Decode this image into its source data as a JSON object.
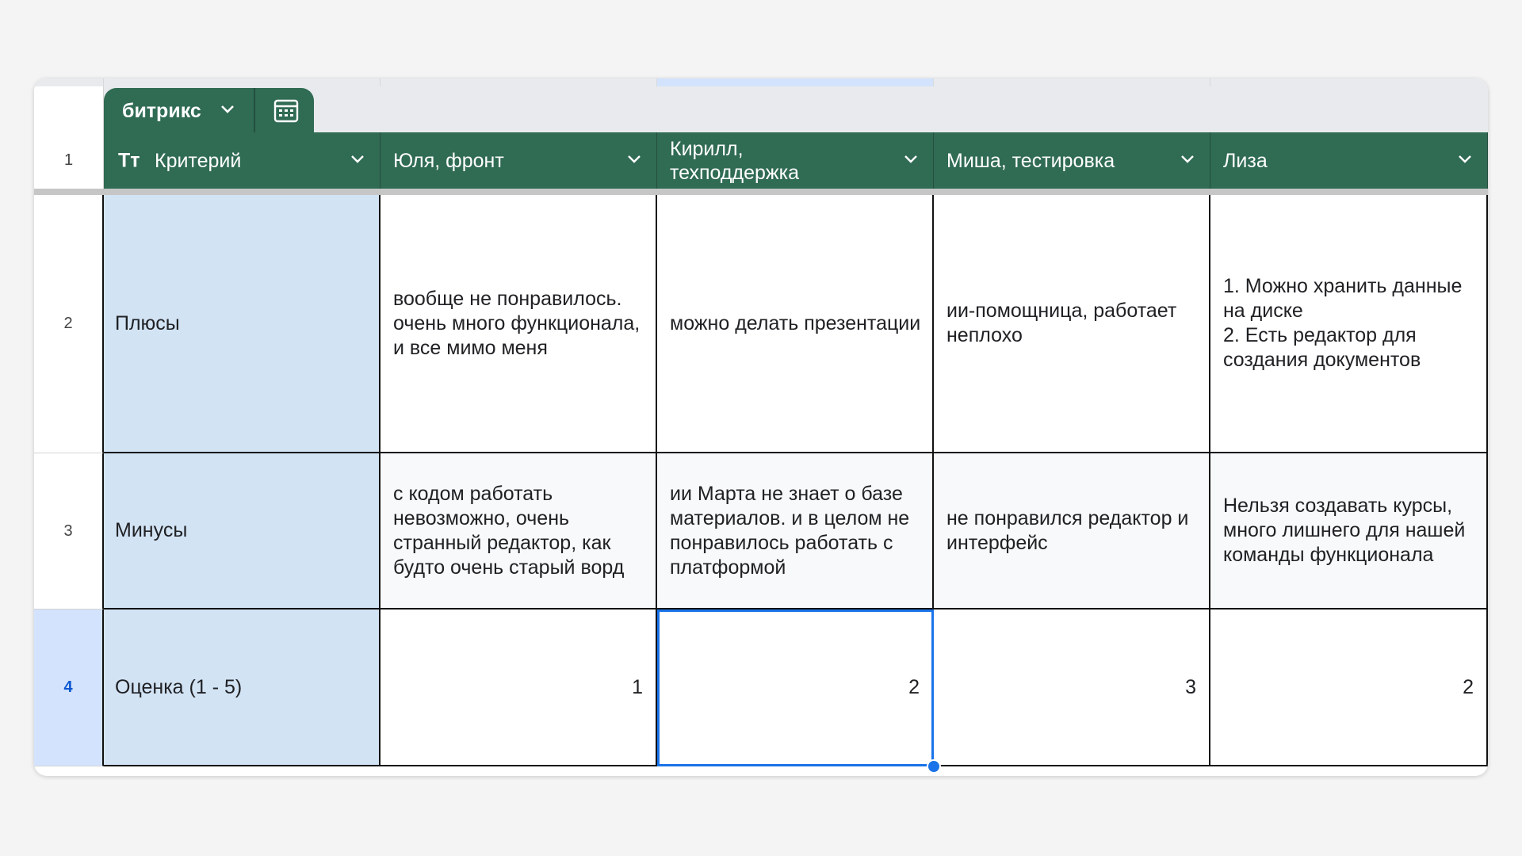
{
  "sheet_tab": {
    "name": "битрикс"
  },
  "header_row_number": "1",
  "columns": [
    {
      "label": "Критерий",
      "type_icon": "Тт"
    },
    {
      "label": "Юля, фронт"
    },
    {
      "label": "Кирилл, техподдержка"
    },
    {
      "label": "Миша, тестировка"
    },
    {
      "label": "Лиза"
    }
  ],
  "rows": [
    {
      "num": "2",
      "criterion": "Плюсы",
      "cells": [
        "вообще не понравилось. очень много функционала, и все мимо меня",
        "можно делать презентации",
        "ии-помощница, работает неплохо",
        "1. Можно хранить данные на диске\n2. Есть редактор для создания документов"
      ]
    },
    {
      "num": "3",
      "criterion": "Минусы",
      "cells": [
        "с кодом работать невозможно, очень странный редактор, как будто очень старый ворд",
        "ии Марта не знает о базе материалов. и в целом не понравилось работать с платформой",
        "не понравился редактор и интерфейс",
        "Нельзя создавать курсы, много лишнего для нашей команды функционала"
      ]
    },
    {
      "num": "4",
      "criterion": "Оценка (1 - 5)",
      "cells": [
        "1",
        "2",
        "3",
        "2"
      ]
    }
  ],
  "colors": {
    "header_green": "#306b54",
    "criterion_blue": "#d2e3f4",
    "selection": "#1a73e8"
  }
}
